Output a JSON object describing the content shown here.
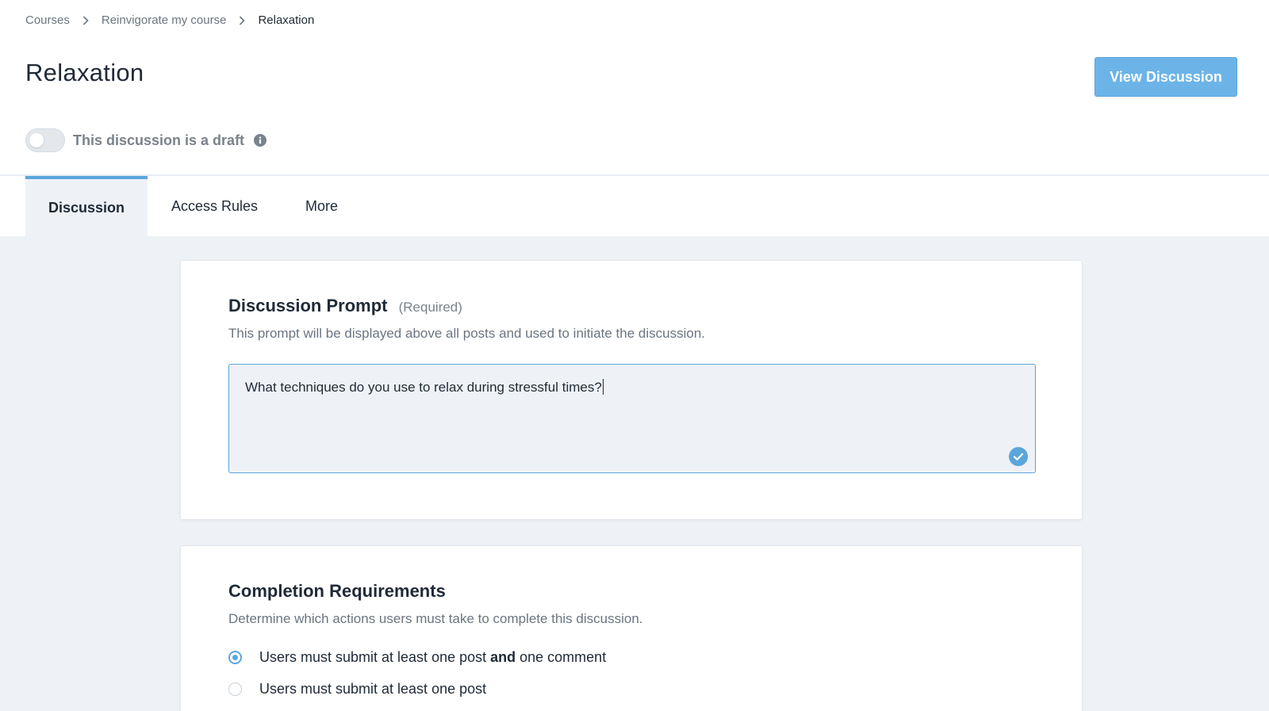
{
  "breadcrumb": {
    "items": [
      "Courses",
      "Reinvigorate my course"
    ],
    "current": "Relaxation"
  },
  "page": {
    "title": "Relaxation",
    "view_button": "View Discussion"
  },
  "draft": {
    "label": "This discussion is a draft",
    "enabled": false
  },
  "tabs": [
    {
      "label": "Discussion",
      "active": true
    },
    {
      "label": "Access Rules",
      "active": false
    },
    {
      "label": "More",
      "active": false
    }
  ],
  "prompt_section": {
    "title": "Discussion Prompt",
    "required": "(Required)",
    "description": "This prompt will be displayed above all posts and used to initiate the discussion.",
    "value": "What techniques do you use to relax during stressful times?"
  },
  "completion_section": {
    "title": "Completion Requirements",
    "description": "Determine which actions users must take to complete this discussion.",
    "options": [
      {
        "pre": "Users must submit at least one post ",
        "bold": "and",
        "post": " one comment",
        "selected": true
      },
      {
        "pre": "Users must submit at least one post",
        "bold": "",
        "post": "",
        "selected": false
      }
    ]
  },
  "colors": {
    "accent": "#5aa6dc",
    "button": "#6cb4e8",
    "background": "#eef2f6"
  },
  "icons": {
    "breadcrumb_separator": "chevron-right-icon",
    "info": "info-icon",
    "valid": "check-circle-icon"
  }
}
